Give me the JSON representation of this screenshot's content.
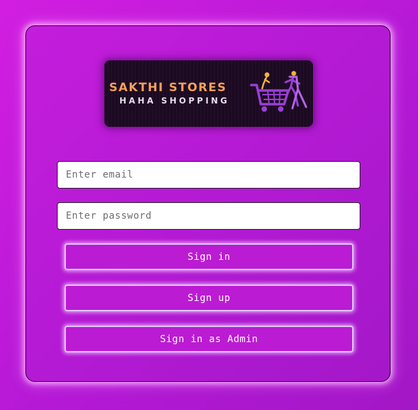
{
  "logo": {
    "title": "SAKTHI STORES",
    "subtitle": "HAHA SHOPPING",
    "icon": "shopping-cart-people-icon"
  },
  "form": {
    "email_placeholder": "Enter email",
    "email_value": "",
    "password_placeholder": "Enter password",
    "password_value": "",
    "signin_label": "Sign in",
    "signup_label": "Sign up",
    "admin_label": "Sign in as Admin"
  },
  "colors": {
    "background": "#c21bdc",
    "card_border": "#2a0533",
    "button_fill": "#bb1bd2",
    "button_border": "#dcc6ff",
    "logo_background": "#1c0a22",
    "logo_title": "#f4a15a",
    "logo_cart": "#9a3fd6"
  }
}
